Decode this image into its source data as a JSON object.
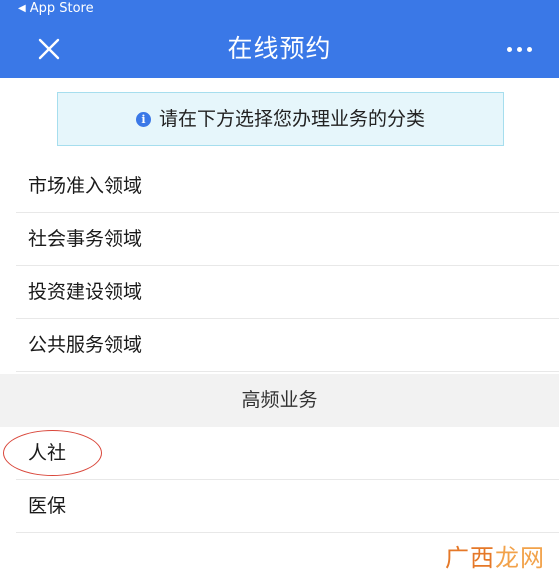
{
  "status_bar": {
    "back_label": "App Store"
  },
  "nav": {
    "title": "在线预约",
    "close_icon": "close-icon",
    "more_icon": "more-dots-icon"
  },
  "notice": {
    "icon": "info-icon",
    "icon_glyph": "i",
    "text": "请在下方选择您办理业务的分类"
  },
  "categories": [
    {
      "label": "市场准入领域"
    },
    {
      "label": "社会事务领域"
    },
    {
      "label": "投资建设领域"
    },
    {
      "label": "公共服务领域"
    }
  ],
  "section": {
    "title": "高频业务"
  },
  "high_frequency": [
    {
      "label": "人社"
    },
    {
      "label": "医保"
    }
  ],
  "watermark": {
    "part1": "广",
    "part2": "西",
    "part3": "龙网"
  },
  "colors": {
    "nav_background": "#3a78e7",
    "notice_background": "#e6f6fb",
    "notice_border": "#a6deee",
    "section_background": "#f2f2f2",
    "annotation_circle": "#d9463a",
    "watermark_orange": "#e57828"
  }
}
